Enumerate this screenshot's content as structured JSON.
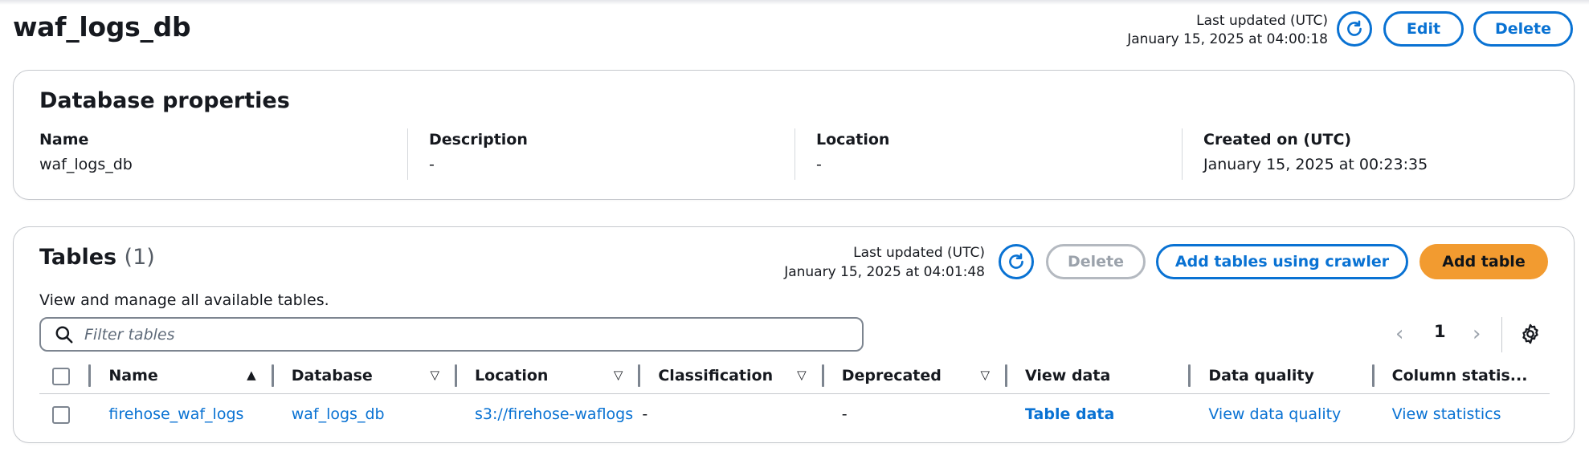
{
  "page": {
    "title": "waf_logs_db",
    "last_updated_label": "Last updated (UTC)",
    "last_updated_value": "January 15, 2025 at 04:00:18",
    "edit_label": "Edit",
    "delete_label": "Delete"
  },
  "properties": {
    "title": "Database properties",
    "items": [
      {
        "label": "Name",
        "value": "waf_logs_db"
      },
      {
        "label": "Description",
        "value": "-"
      },
      {
        "label": "Location",
        "value": "-"
      },
      {
        "label": "Created on (UTC)",
        "value": "January 15, 2025 at 00:23:35"
      }
    ]
  },
  "tables": {
    "title": "Tables",
    "count": "(1)",
    "description": "View and manage all available tables.",
    "last_updated_label": "Last updated (UTC)",
    "last_updated_value": "January 15, 2025 at 04:01:48",
    "delete_label": "Delete",
    "crawler_label": "Add tables using crawler",
    "add_label": "Add table",
    "filter_placeholder": "Filter tables",
    "page_number": "1",
    "columns": [
      "Name",
      "Database",
      "Location",
      "Classification",
      "Deprecated",
      "View data",
      "Data quality",
      "Column statis..."
    ],
    "rows": [
      {
        "name": "firehose_waf_logs",
        "database": "waf_logs_db",
        "location": "s3://firehose-waflogs",
        "classification": "-",
        "deprecated": "-",
        "view_data": "Table data",
        "data_quality": "View data quality",
        "column_statistics": "View statistics"
      }
    ]
  },
  "colors": {
    "accent": "#0972d3",
    "primary_button": "#f29b30",
    "disabled": "#9ba2ab"
  },
  "icons": [
    "refresh-icon",
    "search-icon",
    "chevron-left-icon",
    "chevron-right-icon",
    "settings-gear-icon",
    "sort-ascending-icon",
    "sort-descending-icon"
  ]
}
